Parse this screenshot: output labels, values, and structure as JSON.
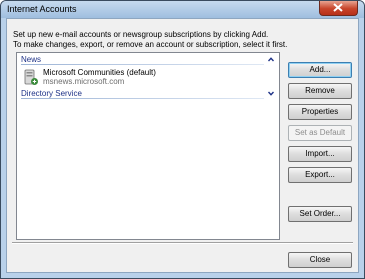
{
  "window": {
    "title": "Internet Accounts"
  },
  "instructions": {
    "line1": "Set up new e-mail accounts or newsgroup subscriptions by clicking Add.",
    "line2": "To make changes, export, or remove an account or subscription, select it first."
  },
  "list": {
    "groups": [
      {
        "label": "News",
        "chevron": "up"
      },
      {
        "label": "Directory Service",
        "chevron": "down"
      }
    ],
    "accounts": [
      {
        "name": "Microsoft Communities (default)",
        "server": "msnews.microsoft.com",
        "icon": "news-server-icon"
      }
    ]
  },
  "buttons": {
    "add": "Add...",
    "remove": "Remove",
    "properties": "Properties",
    "set_default": "Set as Default",
    "import": "Import...",
    "export": "Export...",
    "set_order": "Set Order...",
    "close": "Close"
  },
  "colors": {
    "group_header_text": "#1e3287",
    "close_button": "#c7442a",
    "dialog_background": "#f0f0f0"
  }
}
